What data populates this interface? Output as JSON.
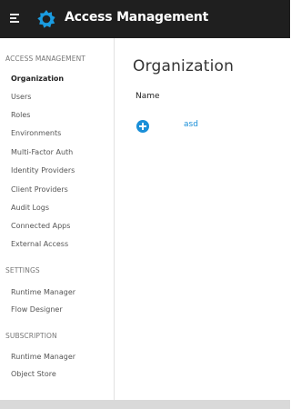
{
  "app": {
    "title": "Access Management",
    "menu_icon": "hamburger-menu-icon",
    "logo_icon": "gear-logo-icon",
    "accent_color": "#1a8fd8",
    "topbar_color": "#1f1f1f"
  },
  "sidebar": {
    "sections": [
      {
        "heading": "ACCESS MANAGEMENT",
        "items": [
          {
            "label": "Organization",
            "active": true
          },
          {
            "label": "Users"
          },
          {
            "label": "Roles"
          },
          {
            "label": "Environments"
          },
          {
            "label": "Multi-Factor Auth"
          },
          {
            "label": "Identity Providers"
          },
          {
            "label": "Client Providers"
          },
          {
            "label": "Audit Logs"
          },
          {
            "label": "Connected Apps"
          },
          {
            "label": "External Access"
          }
        ]
      },
      {
        "heading": "SETTINGS",
        "items": [
          {
            "label": "Runtime Manager"
          },
          {
            "label": "Flow Designer"
          }
        ]
      },
      {
        "heading": "SUBSCRIPTION",
        "items": [
          {
            "label": "Runtime Manager"
          },
          {
            "label": "Object Store"
          }
        ]
      }
    ]
  },
  "main": {
    "title": "Organization",
    "table": {
      "column_header": "Name",
      "rows": [
        {
          "add_icon": "plus-circle-icon",
          "name": "asd"
        }
      ]
    }
  }
}
